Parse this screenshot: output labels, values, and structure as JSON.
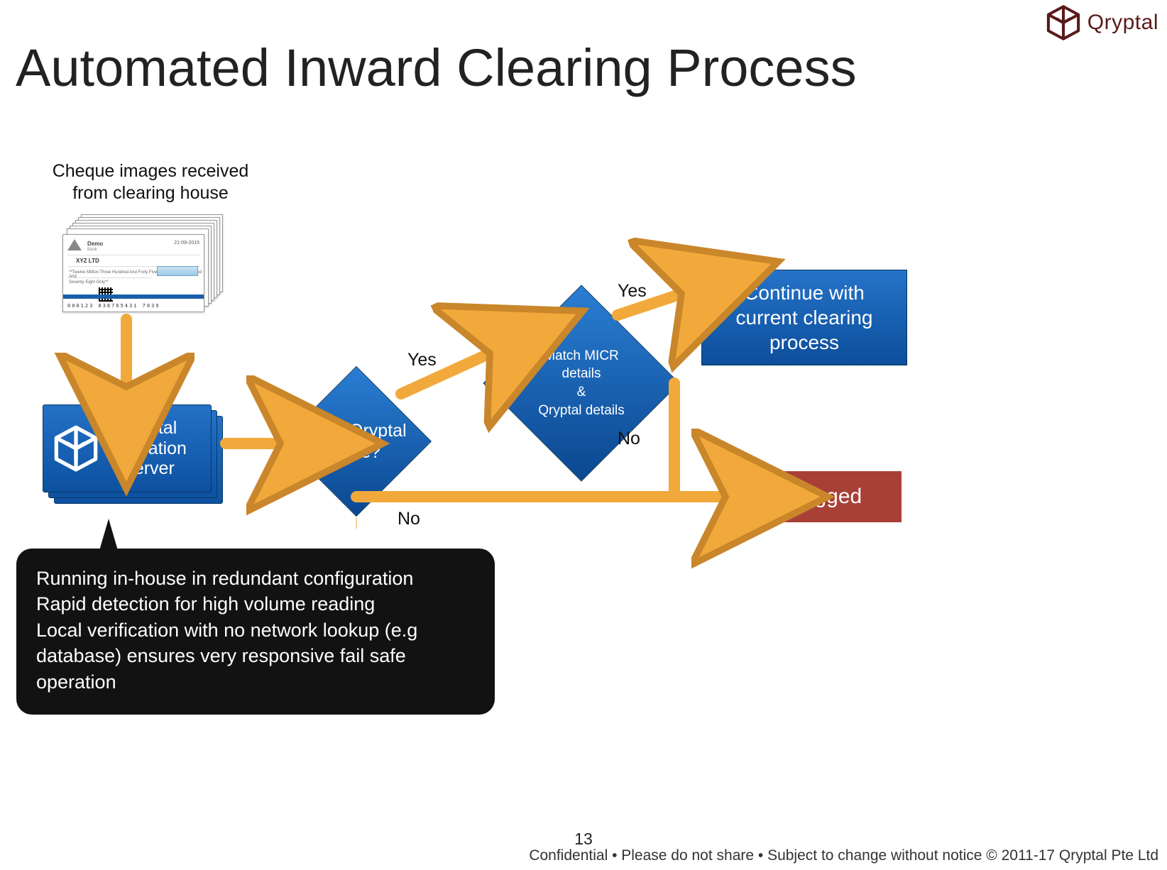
{
  "brand": {
    "name": "Qryptal"
  },
  "title": "Automated Inward Clearing Process",
  "cheque_label": "Cheque images received from clearing house",
  "cheque_sample": {
    "bank_name": "Demo",
    "bank_sub": "Bank",
    "payee": "XYZ LTD",
    "date": "21-09-2015",
    "amount_words_line1": "**Twelve Million Three Hundred And Forty Five Thousand Six Hundred And",
    "amount_words_line2": "Seventy Eight Only**",
    "micr": "000123   838765431      7039"
  },
  "server": {
    "label_l1": "Qryptal",
    "label_l2": "Validation",
    "label_l3": "Server"
  },
  "decision1": "Valid Qryptal code?",
  "decision2": {
    "l1": "Match MICR",
    "l2": "details",
    "l3": "&",
    "l4": "Qryptal details"
  },
  "continue_box": {
    "l1": "Continue with",
    "l2": "current clearing",
    "l3": "process"
  },
  "flagged_box": "Flagged",
  "labels": {
    "yes": "Yes",
    "no": "No"
  },
  "callout": {
    "l1": "Running in-house in redundant configuration",
    "l2": "Rapid detection for high volume reading",
    "l3": "Local verification with no network lookup (e.g",
    "l4": "database) ensures very responsive fail safe operation"
  },
  "page_number": "13",
  "footer": "Confidential • Please do not share • Subject to change without notice © 2011-17 Qryptal Pte Ltd",
  "colors": {
    "blue_top": "#2573c8",
    "blue_bottom": "#0c4e9b",
    "arrow": "#f2a93b",
    "flagged": "#a84038",
    "brand": "#5a1a1a"
  }
}
